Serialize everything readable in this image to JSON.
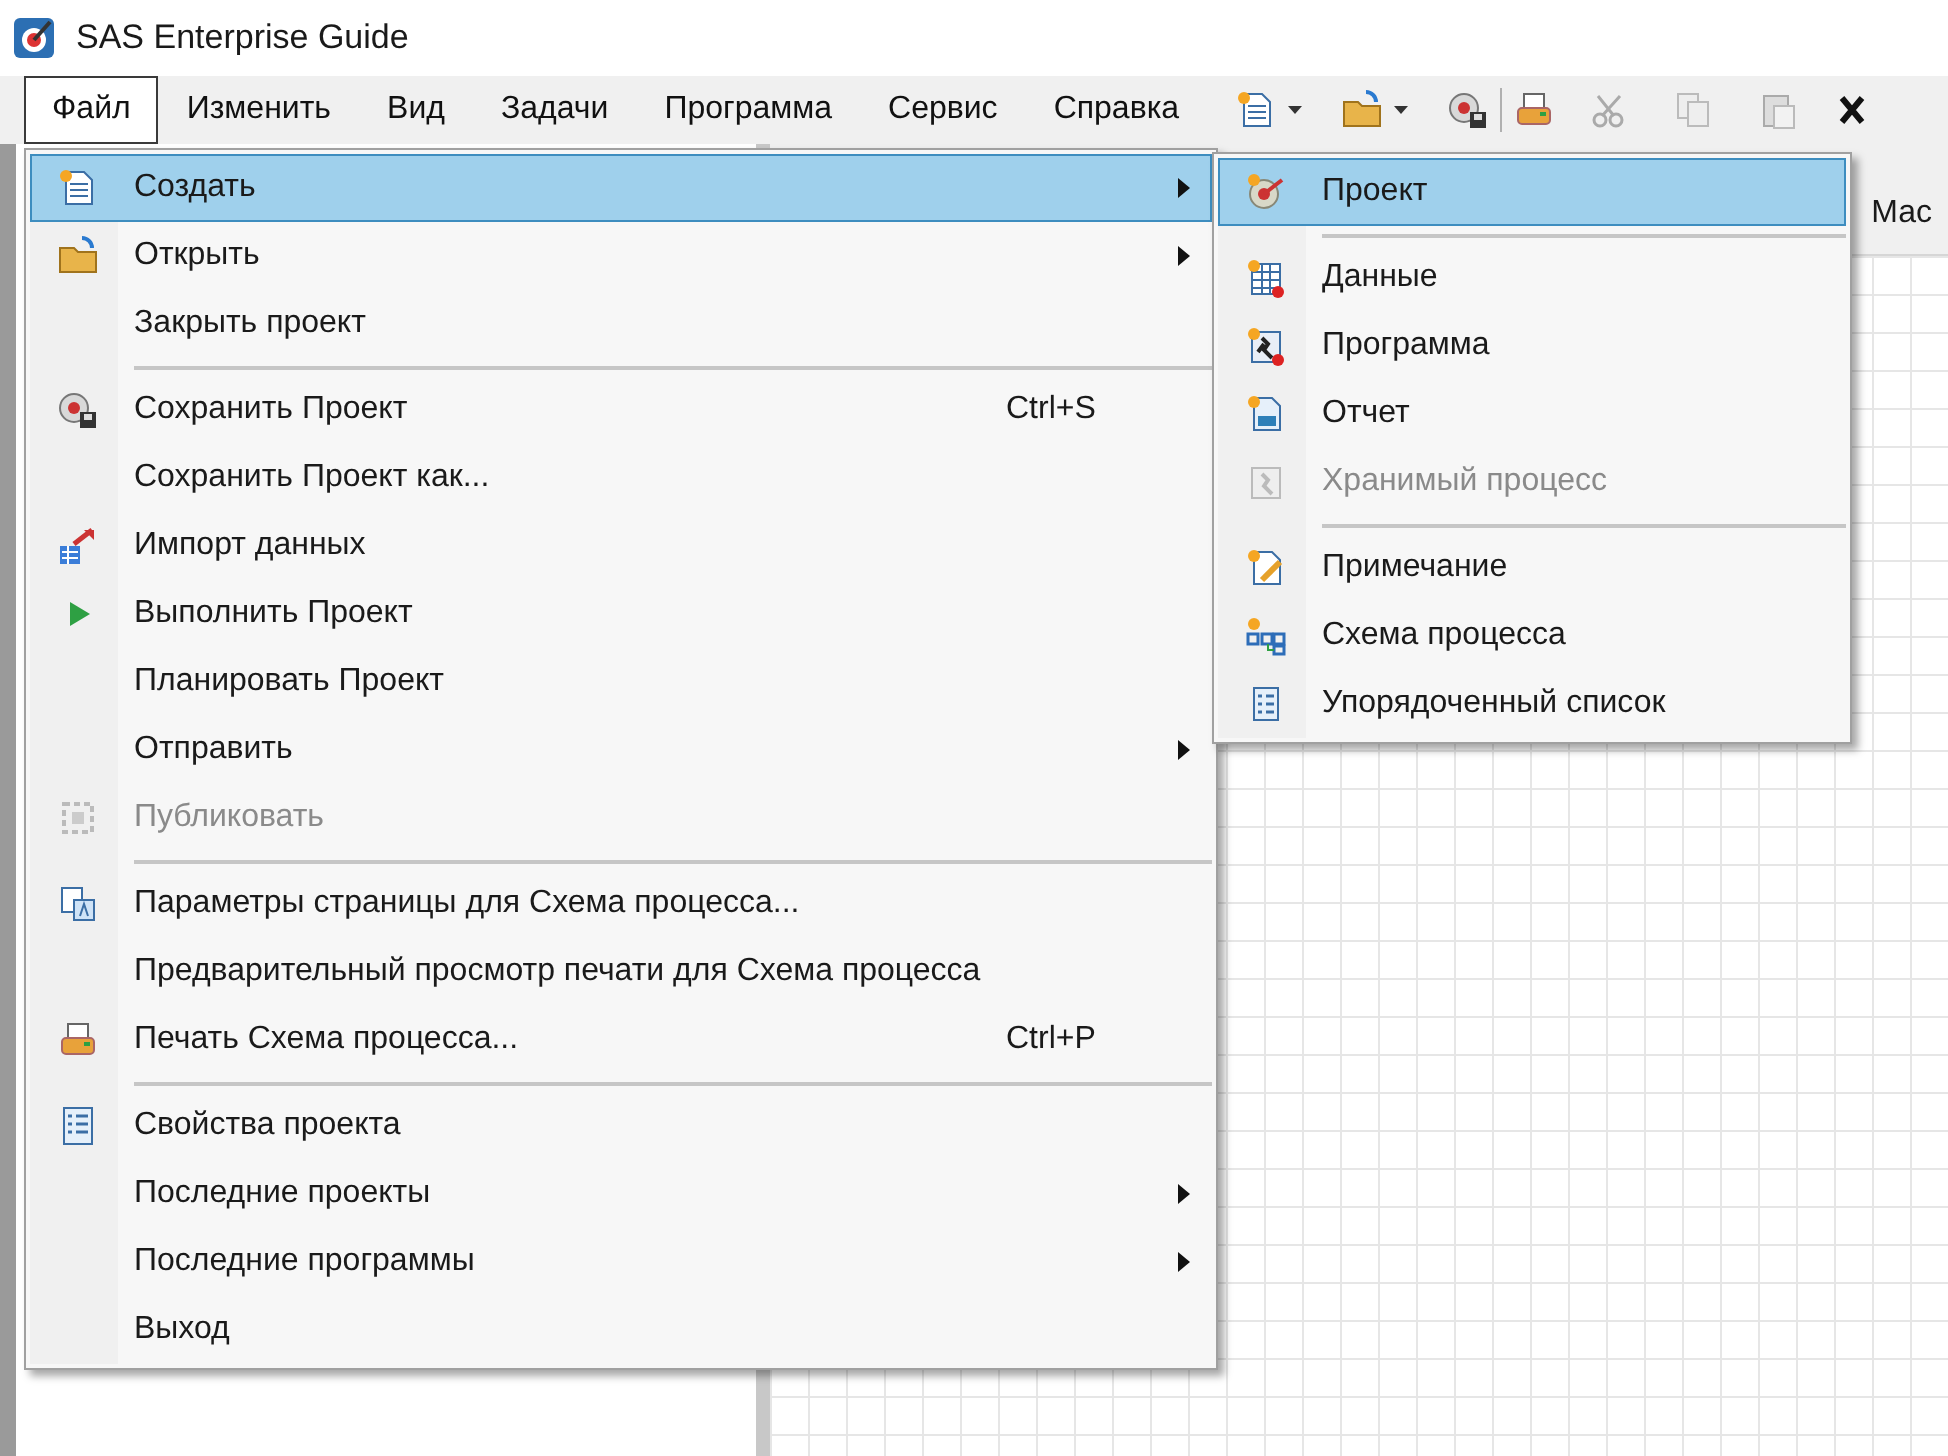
{
  "window": {
    "title": "SAS Enterprise Guide"
  },
  "menubar": [
    {
      "label": "Файл",
      "selected": true
    },
    {
      "label": "Изменить",
      "selected": false
    },
    {
      "label": "Вид",
      "selected": false
    },
    {
      "label": "Задачи",
      "selected": false
    },
    {
      "label": "Программа",
      "selected": false
    },
    {
      "label": "Сервис",
      "selected": false
    },
    {
      "label": "Справка",
      "selected": false
    }
  ],
  "background_tab": {
    "label": "Мас"
  },
  "file_menu": {
    "items": [
      {
        "kind": "item",
        "label": "Создать",
        "selected": true,
        "disabled": false,
        "submenu": true
      },
      {
        "kind": "item",
        "label": "Открыть",
        "selected": false,
        "disabled": false,
        "submenu": true
      },
      {
        "kind": "item",
        "label": "Закрыть проект",
        "selected": false,
        "disabled": false,
        "submenu": false
      },
      {
        "kind": "separator"
      },
      {
        "kind": "item",
        "label": "Сохранить Проект",
        "shortcut": "Ctrl+S",
        "selected": false,
        "disabled": false,
        "submenu": false
      },
      {
        "kind": "item",
        "label": "Сохранить Проект как...",
        "selected": false,
        "disabled": false,
        "submenu": false
      },
      {
        "kind": "item",
        "label": "Импорт данных",
        "selected": false,
        "disabled": false,
        "submenu": false
      },
      {
        "kind": "item",
        "label": "Выполнить Проект",
        "selected": false,
        "disabled": false,
        "submenu": false
      },
      {
        "kind": "item",
        "label": "Планировать Проект",
        "selected": false,
        "disabled": false,
        "submenu": false
      },
      {
        "kind": "item",
        "label": "Отправить",
        "selected": false,
        "disabled": false,
        "submenu": true
      },
      {
        "kind": "item",
        "label": "Публиковать",
        "selected": false,
        "disabled": true,
        "submenu": false
      },
      {
        "kind": "separator"
      },
      {
        "kind": "item",
        "label": "Параметры страницы для Схема процесса...",
        "selected": false,
        "disabled": false,
        "submenu": false
      },
      {
        "kind": "item",
        "label": "Предварительный просмотр печати для Схема процесса",
        "selected": false,
        "disabled": false,
        "submenu": false
      },
      {
        "kind": "item",
        "label": "Печать Схема процесса...",
        "shortcut": "Ctrl+P",
        "selected": false,
        "disabled": false,
        "submenu": false
      },
      {
        "kind": "separator"
      },
      {
        "kind": "item",
        "label": "Свойства проекта",
        "selected": false,
        "disabled": false,
        "submenu": false
      },
      {
        "kind": "item",
        "label": "Последние проекты",
        "selected": false,
        "disabled": false,
        "submenu": true
      },
      {
        "kind": "item",
        "label": "Последние программы",
        "selected": false,
        "disabled": false,
        "submenu": true
      },
      {
        "kind": "item",
        "label": "Выход",
        "selected": false,
        "disabled": false,
        "submenu": false
      }
    ]
  },
  "create_submenu": {
    "items": [
      {
        "kind": "item",
        "label": "Проект",
        "selected": true,
        "disabled": false
      },
      {
        "kind": "separator"
      },
      {
        "kind": "item",
        "label": "Данные",
        "selected": false,
        "disabled": false
      },
      {
        "kind": "item",
        "label": "Программа",
        "selected": false,
        "disabled": false
      },
      {
        "kind": "item",
        "label": "Отчет",
        "selected": false,
        "disabled": false
      },
      {
        "kind": "item",
        "label": "Хранимый процесс",
        "selected": false,
        "disabled": true
      },
      {
        "kind": "separator"
      },
      {
        "kind": "item",
        "label": "Примечание",
        "selected": false,
        "disabled": false
      },
      {
        "kind": "item",
        "label": "Схема процесса",
        "selected": false,
        "disabled": false
      },
      {
        "kind": "item",
        "label": "Упорядоченный список",
        "selected": false,
        "disabled": false
      }
    ]
  }
}
